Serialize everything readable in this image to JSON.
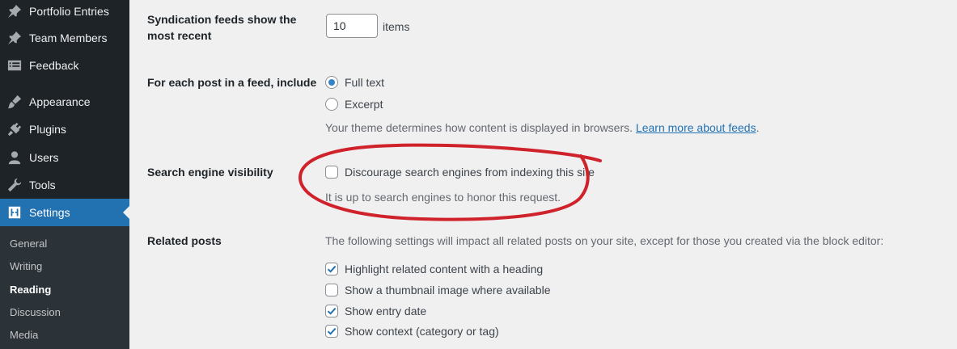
{
  "sidebar": {
    "items": [
      {
        "label": "Portfolio Entries",
        "icon": "pin-icon"
      },
      {
        "label": "Team Members",
        "icon": "pin-icon"
      },
      {
        "label": "Feedback",
        "icon": "feedback-icon"
      },
      {
        "label": "Appearance",
        "icon": "brush-icon"
      },
      {
        "label": "Plugins",
        "icon": "plugin-icon"
      },
      {
        "label": "Users",
        "icon": "user-icon"
      },
      {
        "label": "Tools",
        "icon": "wrench-icon"
      },
      {
        "label": "Settings",
        "icon": "settings-icon",
        "current": true
      }
    ],
    "submenu": [
      {
        "label": "General"
      },
      {
        "label": "Writing"
      },
      {
        "label": "Reading",
        "current": true
      },
      {
        "label": "Discussion"
      },
      {
        "label": "Media"
      }
    ]
  },
  "settings": {
    "syndication": {
      "label": "Syndication feeds show the most recent",
      "value": "10",
      "suffix": "items"
    },
    "feed_content": {
      "label": "For each post in a feed, include",
      "options": [
        {
          "label": "Full text",
          "checked": true
        },
        {
          "label": "Excerpt",
          "checked": false
        }
      ],
      "description": "Your theme determines how content is displayed in browsers.",
      "link": "Learn more about feeds",
      "link_suffix": "."
    },
    "search_visibility": {
      "label": "Search engine visibility",
      "checkbox_label": "Discourage search engines from indexing this site",
      "checked": false,
      "description": "It is up to search engines to honor this request."
    },
    "related_posts": {
      "label": "Related posts",
      "intro": "The following settings will impact all related posts on your site, except for those you created via the block editor:",
      "options": [
        {
          "label": "Highlight related content with a heading",
          "checked": true
        },
        {
          "label": "Show a thumbnail image where available",
          "checked": false
        },
        {
          "label": "Show entry date",
          "checked": true
        },
        {
          "label": "Show context (category or tag)",
          "checked": true
        }
      ]
    }
  },
  "colors": {
    "sidebar_bg": "#1d2327",
    "submenu_bg": "#2c3338",
    "accent": "#2271b1",
    "annotation": "#d0222a"
  }
}
